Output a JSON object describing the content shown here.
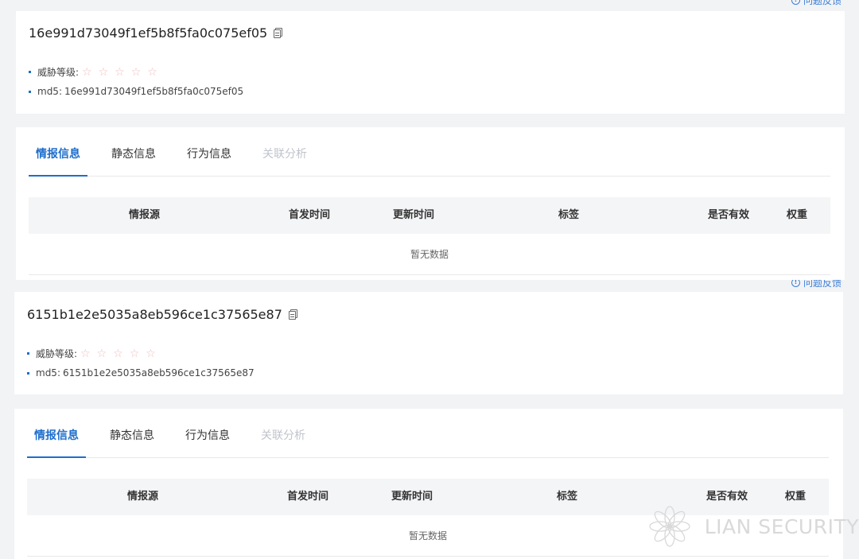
{
  "feedback_label": "问题反馈",
  "reports": [
    {
      "hash_title": "16e991d73049f1ef5b8f5fa0c075ef05",
      "threat_level_label": "威胁等级:",
      "threat_level_stars": 0,
      "threat_level_max": 5,
      "md5_label": "md5:",
      "md5_value": "16e991d73049f1ef5b8f5fa0c075ef05",
      "tabs": [
        {
          "label": "情报信息",
          "state": "active"
        },
        {
          "label": "静态信息",
          "state": "normal"
        },
        {
          "label": "行为信息",
          "state": "normal"
        },
        {
          "label": "关联分析",
          "state": "disabled"
        }
      ],
      "table": {
        "columns": [
          "情报源",
          "首发时间",
          "更新时间",
          "标签",
          "是否有效",
          "权重"
        ],
        "empty_text": "暂无数据"
      }
    },
    {
      "hash_title": "6151b1e2e5035a8eb596ce1c37565e87",
      "threat_level_label": "威胁等级:",
      "threat_level_stars": 0,
      "threat_level_max": 5,
      "md5_label": "md5:",
      "md5_value": "6151b1e2e5035a8eb596ce1c37565e87",
      "tabs": [
        {
          "label": "情报信息",
          "state": "active"
        },
        {
          "label": "静态信息",
          "state": "normal"
        },
        {
          "label": "行为信息",
          "state": "normal"
        },
        {
          "label": "关联分析",
          "state": "disabled"
        }
      ],
      "table": {
        "columns": [
          "情报源",
          "首发时间",
          "更新时间",
          "标签",
          "是否有效",
          "权重"
        ],
        "empty_text": "暂无数据"
      }
    }
  ],
  "watermark": {
    "text": "LIAN SECURITY",
    "icon": "lotus-logo-icon"
  },
  "colors": {
    "accent": "#1e6ecc",
    "star_empty": "#f3bcbc",
    "background": "#f2f3f5"
  }
}
